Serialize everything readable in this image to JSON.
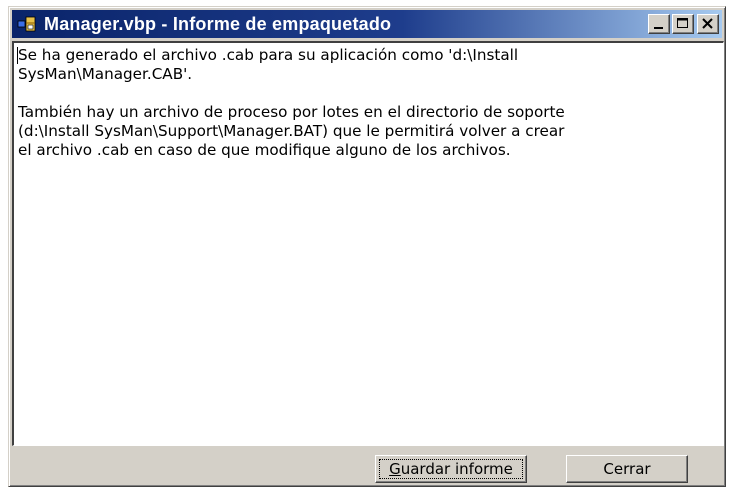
{
  "window": {
    "title": "Manager.vbp - Informe de empaquetado",
    "icon": "package-app-icon"
  },
  "titlebar_buttons": {
    "minimize_icon": "minimize-icon",
    "maximize_icon": "maximize-icon",
    "close_icon": "close-icon"
  },
  "report": {
    "line1": "Se ha generado el archivo .cab para su aplicación como 'd:\\Install",
    "line2": "SysMan\\Manager.CAB'.",
    "line3": "También hay un archivo de proceso por lotes en el directorio de soporte",
    "line4": "(d:\\Install SysMan\\Support\\Manager.BAT) que le permitirá volver a crear",
    "line5": "el archivo .cab en caso de que modifique alguno de los archivos."
  },
  "buttons": {
    "save_mnemonic": "G",
    "save_rest": "uardar informe",
    "close_label": "Cerrar"
  },
  "colors": {
    "titlebar_start": "#0a246a",
    "titlebar_end": "#a6caf0",
    "face": "#d4d0c8"
  }
}
